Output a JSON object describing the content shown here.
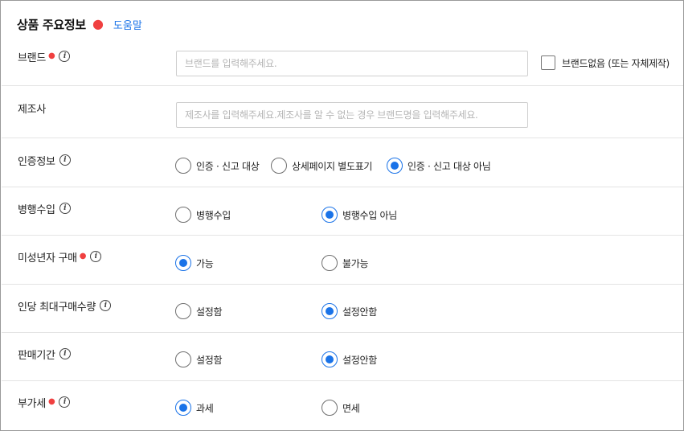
{
  "section": {
    "title": "상품 주요정보",
    "help_link": "도움말"
  },
  "brand": {
    "label": "브랜드",
    "placeholder": "브랜드를 입력해주세요.",
    "value": "",
    "no_brand_checkbox": {
      "label": "브랜드없음 (또는 자체제작)",
      "checked": false
    }
  },
  "manufacturer": {
    "label": "제조사",
    "placeholder": "제조사를 입력해주세요.제조사를 알 수 없는 경우 브랜드명을 입력해주세요.",
    "value": ""
  },
  "certification": {
    "label": "인증정보",
    "options": [
      "인증 · 신고 대상",
      "상세페이지 별도표기",
      "인증 · 신고 대상 아님"
    ],
    "selected": 2
  },
  "parallel_import": {
    "label": "병행수입",
    "options": [
      "병행수입",
      "병행수입 아님"
    ],
    "selected": 1
  },
  "minor_purchase": {
    "label": "미성년자 구매",
    "options": [
      "가능",
      "불가능"
    ],
    "selected": 0
  },
  "max_purchase": {
    "label": "인당 최대구매수량",
    "options": [
      "설정함",
      "설정안함"
    ],
    "selected": 1
  },
  "sale_period": {
    "label": "판매기간",
    "options": [
      "설정함",
      "설정안함"
    ],
    "selected": 1
  },
  "vat": {
    "label": "부가세",
    "options": [
      "과세",
      "면세"
    ],
    "selected": 0
  },
  "colors": {
    "accent": "#1a73e8",
    "required_dot": "#f04040",
    "divider": "#e4e4e4"
  }
}
